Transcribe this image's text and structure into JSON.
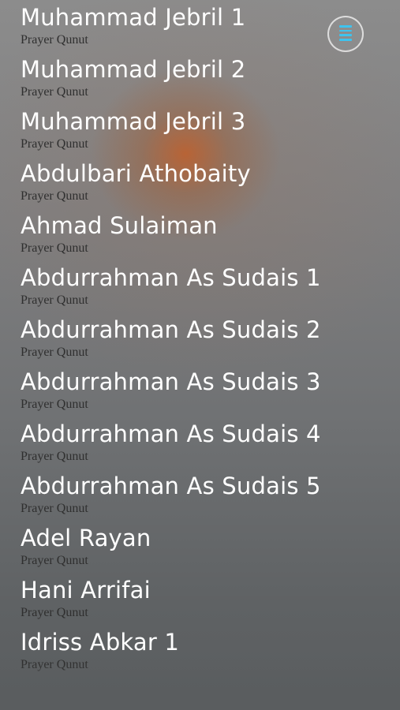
{
  "reciters": [
    {
      "name": "Muhammad Jebril 1",
      "subtitle": "Prayer Qunut"
    },
    {
      "name": "Muhammad Jebril 2",
      "subtitle": "Prayer Qunut"
    },
    {
      "name": "Muhammad Jebril 3",
      "subtitle": "Prayer Qunut"
    },
    {
      "name": "Abdulbari Athobaity",
      "subtitle": "Prayer Qunut"
    },
    {
      "name": "Ahmad Sulaiman",
      "subtitle": "Prayer Qunut"
    },
    {
      "name": "Abdurrahman As Sudais 1",
      "subtitle": "Prayer Qunut"
    },
    {
      "name": "Abdurrahman As Sudais 2",
      "subtitle": "Prayer Qunut"
    },
    {
      "name": "Abdurrahman As Sudais 3",
      "subtitle": "Prayer Qunut"
    },
    {
      "name": "Abdurrahman As Sudais 4",
      "subtitle": "Prayer Qunut"
    },
    {
      "name": "Abdurrahman As Sudais 5",
      "subtitle": "Prayer Qunut"
    },
    {
      "name": "Adel Rayan",
      "subtitle": "Prayer Qunut"
    },
    {
      "name": "Hani Arrifai",
      "subtitle": "Prayer Qunut"
    },
    {
      "name": "Idriss Abkar 1",
      "subtitle": "Prayer Qunut"
    }
  ],
  "menu_button": {
    "icon": "menu-icon",
    "color": "#3ec3ee"
  }
}
